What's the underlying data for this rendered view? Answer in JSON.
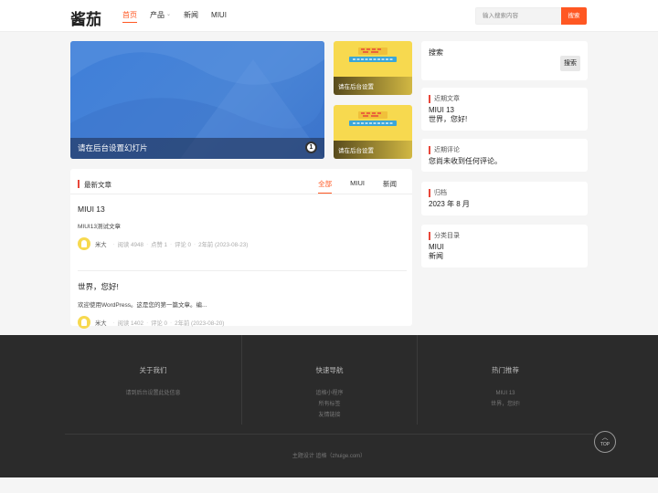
{
  "header": {
    "logo": "酱茄",
    "nav": [
      {
        "label": "首页",
        "active": true
      },
      {
        "label": "产品",
        "has_dropdown": true
      },
      {
        "label": "新闻"
      },
      {
        "label": "MIUI"
      }
    ],
    "search_placeholder": "输入搜索内容",
    "search_button": "搜索"
  },
  "slider": {
    "caption": "请在后台设置幻灯片",
    "page_number": "1"
  },
  "thumbnails": [
    {
      "caption": "请在后台设置"
    },
    {
      "caption": "请在后台设置"
    }
  ],
  "latest": {
    "title": "最新文章",
    "tabs": [
      {
        "label": "全部",
        "active": true
      },
      {
        "label": "MIUI"
      },
      {
        "label": "新闻"
      }
    ],
    "posts": [
      {
        "title": "MIUI 13",
        "excerpt": "MIUI13测试文章",
        "author": "米大",
        "views": "阅读 4948",
        "likes": "点赞 1",
        "comments": "评论 0",
        "time": "2年前 (2023-08-23)"
      },
      {
        "title": "世界，您好!",
        "excerpt": "欢迎使用WordPress。这是您的第一篇文章。编...",
        "author": "米大",
        "views": "阅读 1402",
        "comments": "评论 0",
        "time": "2年前 (2023-08-20)"
      }
    ]
  },
  "sidebar": {
    "search_title": "搜索",
    "search_button": "搜索",
    "recent_posts": {
      "title": "近期文章",
      "items": [
        "MIUI 13",
        "世界，您好!"
      ]
    },
    "recent_comments": {
      "title": "近期评论",
      "text": "您尚未收到任何评论。"
    },
    "archives": {
      "title": "归档",
      "items": [
        "2023 年 8 月"
      ]
    },
    "categories": {
      "title": "分类目录",
      "items": [
        "MIUI",
        "新闻"
      ]
    }
  },
  "footer": {
    "columns": [
      {
        "title": "关于我们",
        "lines": [
          "请到后台设置此处信息"
        ]
      },
      {
        "title": "快速导航",
        "lines": [
          "追格小程序",
          "所有标签",
          "友情链接"
        ]
      },
      {
        "title": "热门推荐",
        "lines": [
          "MIUI 13",
          "世界，您好!"
        ]
      }
    ],
    "copyright": "主题设计 追格（zhuige.com）",
    "top_label": "TOP"
  },
  "colors": {
    "accent": "#ff5722",
    "section_bar": "#e8473a",
    "footer_bg": "#2b2b2b",
    "slider_blue": "#4a85d6",
    "thumb_yellow": "#f7d94f"
  }
}
